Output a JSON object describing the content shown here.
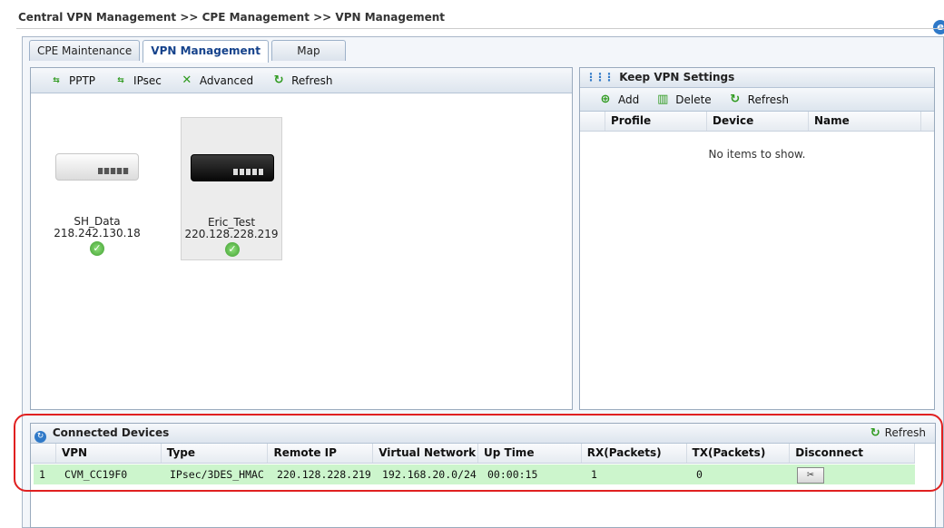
{
  "breadcrumb": "Central VPN Management >> CPE Management >> VPN Management",
  "tabs": [
    {
      "label": "CPE Maintenance",
      "active": false
    },
    {
      "label": "VPN Management",
      "active": true
    },
    {
      "label": "Map",
      "active": false
    }
  ],
  "left_toolbar": {
    "pptp": "PPTP",
    "ipsec": "IPsec",
    "advanced": "Advanced",
    "refresh": "Refresh"
  },
  "devices": [
    {
      "name": "SH_Data",
      "ip": "218.242.130.18",
      "status": "connected",
      "selected": false
    },
    {
      "name": "Eric_Test",
      "ip": "220.128.228.219",
      "status": "connected",
      "selected": true
    }
  ],
  "keep_vpn": {
    "title": "Keep VPN Settings",
    "add": "Add",
    "delete": "Delete",
    "refresh": "Refresh",
    "columns": [
      "Profile",
      "Device",
      "Name"
    ],
    "empty_text": "No items to show."
  },
  "connected": {
    "title": "Connected Devices",
    "refresh": "Refresh",
    "columns": [
      "VPN",
      "Type",
      "Remote IP",
      "Virtual Network",
      "Up Time",
      "RX(Packets)",
      "TX(Packets)",
      "Disconnect"
    ],
    "rows": [
      {
        "index": "1",
        "vpn": "CVM_CC19F0",
        "type": "IPsec/3DES_HMAC",
        "remote_ip": "220.128.228.219",
        "virtual_network": "192.168.20.0/24",
        "up_time": "00:00:15",
        "rx": "1",
        "tx": "0"
      }
    ]
  },
  "colors": {
    "row_green": "#ccf5cc",
    "accent_blue": "#15428b",
    "highlight_red": "#e02020"
  }
}
